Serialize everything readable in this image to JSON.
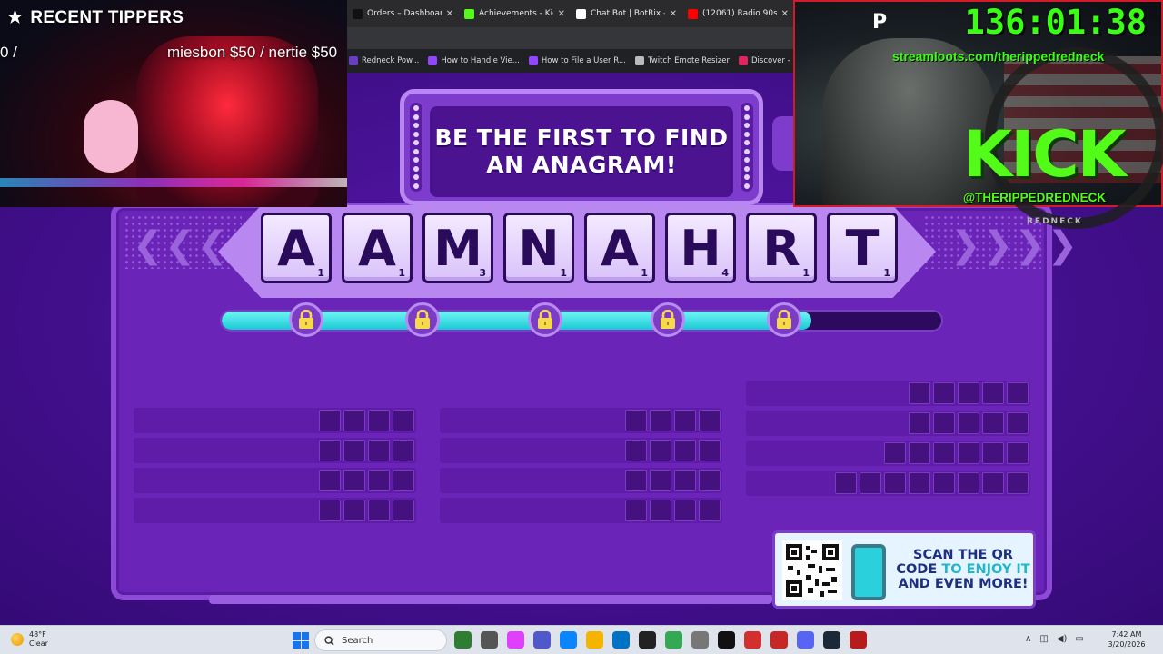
{
  "browser": {
    "tabs": [
      {
        "label": "Orders – Dashboard",
        "close": "✕",
        "favicon_color": "#111111"
      },
      {
        "label": "Achievements - Kick D",
        "close": "✕",
        "favicon_color": "#53fc18"
      },
      {
        "label": "Chat Bot | BotRix — Cl",
        "close": "✕",
        "favicon_color": "#ffffff"
      },
      {
        "label": "(12061) Radio 90s",
        "close": "✕",
        "favicon_color": "#ff0000"
      }
    ],
    "bookmarks": [
      {
        "label": "Redneck Pow...",
        "favicon_color": "#6a3ec0"
      },
      {
        "label": "How to Handle Vie...",
        "favicon_color": "#9146ff"
      },
      {
        "label": "How to File a User R...",
        "favicon_color": "#9146ff"
      },
      {
        "label": "Twitch Emote Resizer",
        "favicon_color": "#bbbbbb"
      },
      {
        "label": "Discover - Find Top...",
        "favicon_color": "#e0245e"
      },
      {
        "label": "",
        "favicon_color": "#53fc18"
      }
    ]
  },
  "stream": {
    "recent_tippers_title": "RECENT TIPPERS",
    "tippers_left": "0 /",
    "tippers_right": "miesbon $50 / nertie $50",
    "timer_prefix": "P",
    "timer": "136:01:38",
    "streamloots_url": "streamloots.com/therippedredneck",
    "kick_logo": "KICK",
    "kick_handle": "@THERIPPEDREDNECK",
    "emblem_text": "REDNECK"
  },
  "game": {
    "banner": "BE THE FIRST TO FIND AN ANAGRAM!",
    "tiles": [
      {
        "letter": "A",
        "score": "1"
      },
      {
        "letter": "A",
        "score": "1"
      },
      {
        "letter": "M",
        "score": "3"
      },
      {
        "letter": "N",
        "score": "1"
      },
      {
        "letter": "A",
        "score": "1"
      },
      {
        "letter": "H",
        "score": "4"
      },
      {
        "letter": "R",
        "score": "1"
      },
      {
        "letter": "T",
        "score": "1"
      }
    ],
    "progress": 0.82,
    "locks": 5,
    "answer_columns": [
      [
        4,
        4,
        4,
        4
      ],
      [
        4,
        4,
        4,
        4
      ],
      [
        5,
        5,
        6,
        8
      ]
    ],
    "qr_text_line1": "SCAN THE QR",
    "qr_text_code": "CODE",
    "qr_text_mid": "TO ENJOY IT",
    "qr_text_line3": "AND EVEN MORE!"
  },
  "taskbar": {
    "weather_temp": "48°F",
    "weather_desc": "Clear",
    "search_label": "Search",
    "time": "7:42 AM",
    "date": "3/20/2026",
    "tray_arrow": "∧",
    "apps": [
      "#2e7d32",
      "#555555",
      "#e040fb",
      "#5059c9",
      "#0a84ff",
      "#f4b400",
      "#0072c6",
      "#222222",
      "#34a853",
      "#777777",
      "#111111",
      "#d32f2f",
      "#c62828",
      "#5865f2",
      "#1b2838",
      "#b71c1c"
    ]
  }
}
